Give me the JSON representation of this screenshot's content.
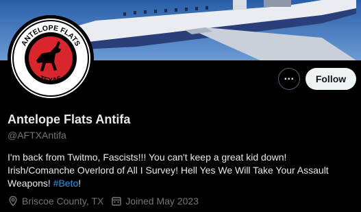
{
  "profile": {
    "name": "Antelope Flats Antifa",
    "handle": "@AFTXAntifa",
    "bio_text": "I'm back from Twitmo, Fascists!!! You can't keep a great kid down! Irish/Comanche Overlord of All I Survey! Hell Yes We Will Take Your Assault Weapons! ",
    "bio_hashtag": "#Beto",
    "bio_end": "!",
    "location": "Briscoe County, TX",
    "joined": "Joined May 2023",
    "avatar_text_top": "ANTELOPE FLATS",
    "avatar_text_bottom": "TEXAS"
  },
  "actions": {
    "more_label": "...",
    "follow_label": "Follow"
  },
  "icons": {
    "more": "more-icon",
    "location": "location-pin-icon",
    "calendar": "calendar-icon"
  },
  "colors": {
    "background": "#000000",
    "link": "#1d9bf0",
    "secondary_text": "#71767b",
    "follow_bg": "#eff3f4",
    "antifa_red": "#d9262d"
  }
}
